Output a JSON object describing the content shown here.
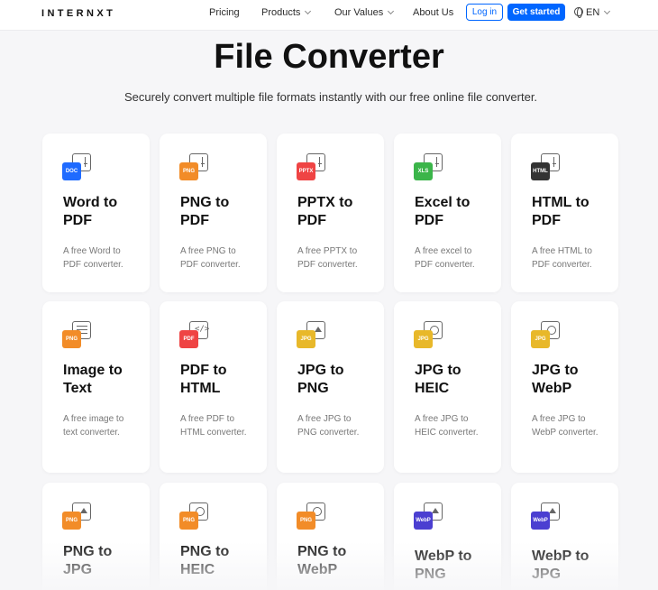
{
  "header": {
    "logo": "INTERNXT",
    "nav": [
      "Pricing",
      "Products",
      "Our Values",
      "About Us"
    ],
    "login": "Log in",
    "get_started": "Get started",
    "lang": "EN"
  },
  "hero": {
    "title": "File Converter",
    "subtitle": "Securely convert multiple file formats instantly with our free online file converter."
  },
  "cards": [
    {
      "badge": "DOC",
      "color": "#1f6bff",
      "title": "Word to PDF",
      "desc": "A free Word to PDF converter."
    },
    {
      "badge": "PNG",
      "color": "#f28c28",
      "title": "PNG to PDF",
      "desc": "A free PNG to PDF converter."
    },
    {
      "badge": "PPTX",
      "color": "#ef4444",
      "title": "PPTX to PDF",
      "desc": "A free PPTX to PDF converter."
    },
    {
      "badge": "XLS",
      "color": "#3bb54a",
      "title": "Excel to PDF",
      "desc": "A free excel to PDF converter."
    },
    {
      "badge": "HTML",
      "color": "#333333",
      "title": "HTML to PDF",
      "desc": "A free HTML to PDF converter."
    },
    {
      "badge": "PNG",
      "color": "#f28c28",
      "title": "Image to Text",
      "desc": "A free image to text converter."
    },
    {
      "badge": "PDF",
      "color": "#ef4444",
      "title": "PDF to HTML",
      "desc": "A free PDF to HTML converter."
    },
    {
      "badge": "JPG",
      "color": "#e8b82a",
      "title": "JPG to PNG",
      "desc": "A free JPG to PNG converter."
    },
    {
      "badge": "JPG",
      "color": "#e8b82a",
      "title": "JPG to HEIC",
      "desc": "A free JPG to HEIC converter."
    },
    {
      "badge": "JPG",
      "color": "#e8b82a",
      "title": "JPG to WebP",
      "desc": "A free JPG to WebP converter."
    },
    {
      "badge": "PNG",
      "color": "#f28c28",
      "title": "PNG to JPG",
      "desc": ""
    },
    {
      "badge": "PNG",
      "color": "#f28c28",
      "title": "PNG to HEIC",
      "desc": ""
    },
    {
      "badge": "PNG",
      "color": "#f28c28",
      "title": "PNG to WebP",
      "desc": ""
    },
    {
      "badge": "WebP",
      "color": "#4b3fd1",
      "title": "WebP to PNG",
      "desc": ""
    },
    {
      "badge": "WebP",
      "color": "#4b3fd1",
      "title": "WebP to JPG",
      "desc": ""
    }
  ]
}
